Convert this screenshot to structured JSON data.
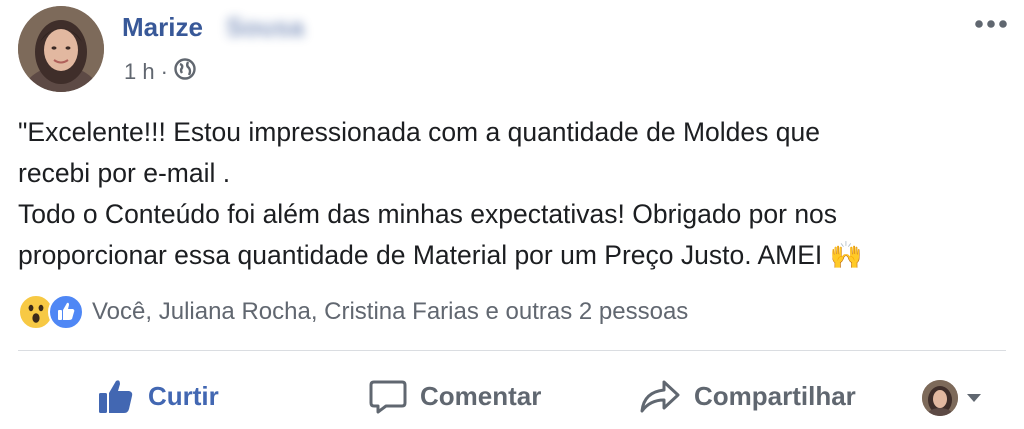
{
  "post": {
    "author": {
      "name": "Marize",
      "surname": "Sousa"
    },
    "timestamp": "1 h",
    "separator": "·",
    "privacy_icon": "globe-icon",
    "more_icon": "more-options-icon",
    "text": {
      "line1": "\"Excelente!!! Estou impressionada com a quantidade de Moldes que",
      "line2": "recebi por e-mail .",
      "line3": "Todo o Conteúdo foi além das minhas expectativas! Obrigado por nos",
      "line4": "proporcionar essa quantidade de Material por um Preço Justo. AMEI",
      "emoji": "🙌"
    }
  },
  "reactions": {
    "icons": [
      "wow-reaction-icon",
      "like-reaction-icon"
    ],
    "summary": "Você, Juliana Rocha, Cristina Farias e outras 2 pessoas"
  },
  "actions": {
    "like_label": "Curtir",
    "comment_label": "Comentar",
    "share_label": "Compartilhar"
  },
  "colors": {
    "name_blue": "#385898",
    "like_blue": "#4267b2",
    "gray_text": "#606770",
    "wow_yellow": "#f7c944"
  }
}
